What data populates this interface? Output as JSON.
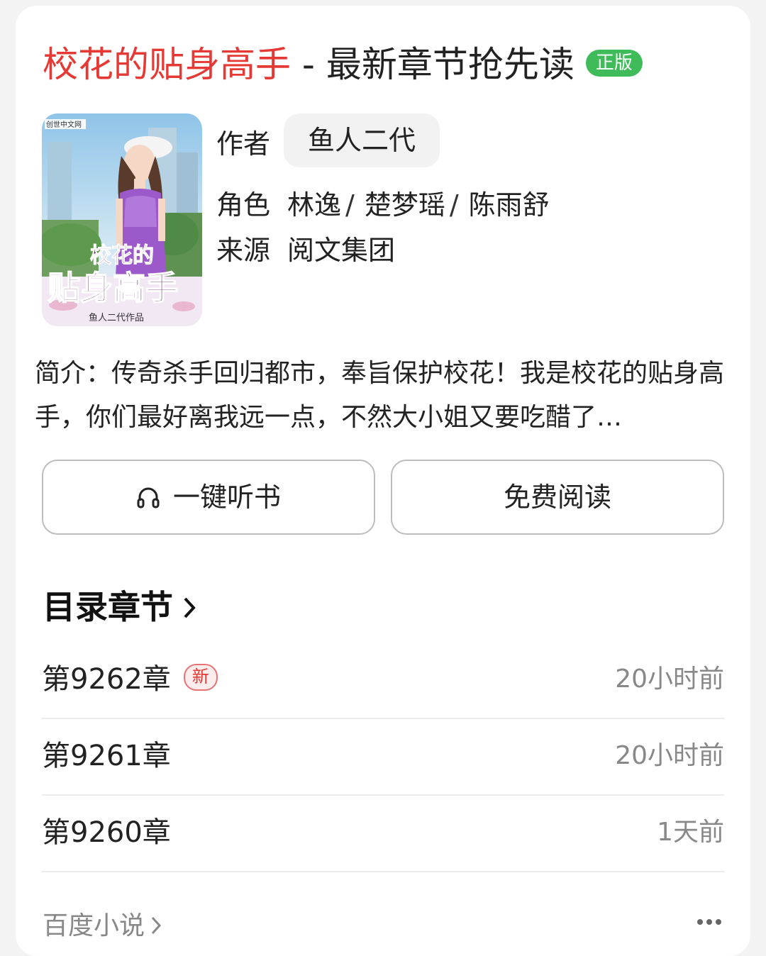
{
  "header": {
    "book_title": "校花的贴身高手",
    "separator": " - ",
    "subtitle": "最新章节抢先读",
    "badge": "正版"
  },
  "book": {
    "cover": {
      "publisher_logo_text": "创世中文网",
      "title_line1": "校花的",
      "title_line2": "贴身高手",
      "byline": "鱼人二代作品"
    },
    "author_label": "作者",
    "author": "鱼人二代",
    "roles_label": "角色",
    "roles": [
      "林逸",
      "楚梦瑶",
      "陈雨舒"
    ],
    "role_separator": "/",
    "source_label": "来源",
    "source": "阅文集团",
    "intro": "简介：传奇杀手回归都市，奉旨保护校花！我是校花的贴身高手，你们最好离我远一点，不然大小姐又要吃醋了…"
  },
  "actions": {
    "listen_label": "一键听书",
    "read_label": "免费阅读"
  },
  "chapters": {
    "section_title": "目录章节",
    "new_tag": "新",
    "items": [
      {
        "title": "第9262章",
        "time": "20小时前"
      },
      {
        "title": "第9261章",
        "time": "20小时前"
      },
      {
        "title": "第9260章",
        "time": "1天前"
      }
    ]
  },
  "footer": {
    "source_link": "百度小说"
  },
  "colors": {
    "accent_red": "#e53935",
    "badge_green": "#3fbb59",
    "muted": "#888888"
  }
}
